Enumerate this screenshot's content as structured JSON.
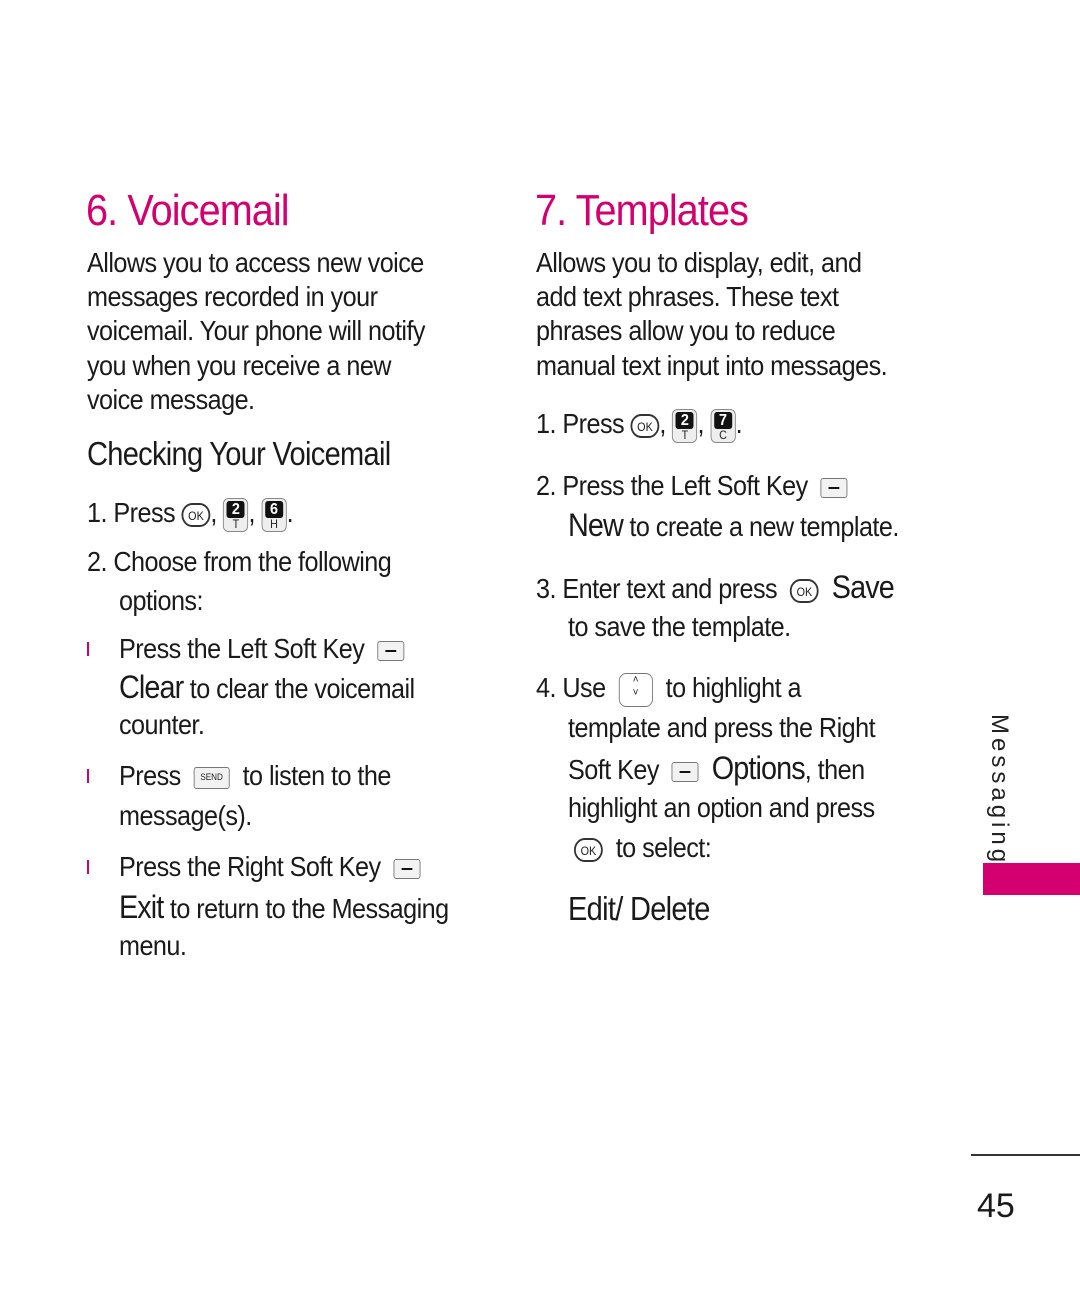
{
  "accent_color": "#d4006f",
  "left": {
    "title": "6. Voicemail",
    "intro": [
      "Allows you to access new voice",
      "messages recorded in your",
      "voicemail. Your phone will notify",
      "you when you receive a new",
      "voice message."
    ],
    "subheading": "Checking Your Voicemail",
    "step1": {
      "prefix": "1. Press",
      "keys": [
        "OK",
        "2",
        "T",
        "6",
        "H"
      ]
    },
    "step2": [
      "2. Choose from the following",
      "options:"
    ],
    "bullet1": {
      "a": "Press the Left Soft Key",
      "b": "Clear",
      "c": " to clear the voicemail",
      "d": "counter."
    },
    "bullet2": {
      "a": "Press",
      "key": "SEND",
      "b": "to listen to the",
      "c": "message(s)."
    },
    "bullet3": {
      "a": "Press the Right Soft Key",
      "b": "Exit",
      "c": " to return to the Messaging",
      "d": "menu."
    }
  },
  "right": {
    "title": "7. Templates",
    "intro": [
      "Allows you to display, edit, and",
      "add text phrases. These text",
      "phrases allow you to reduce",
      "manual text input into messages."
    ],
    "step1": {
      "prefix": "1. Press",
      "keys": [
        "OK",
        "2",
        "T",
        "7",
        "C"
      ]
    },
    "step2": {
      "a": "2. Press the Left Soft Key",
      "b": "New",
      "c": " to create a new template."
    },
    "step3": {
      "a": "3. Enter text and press",
      "b": "Save",
      "c": "to save the template."
    },
    "step4": {
      "a": "4. Use",
      "b": "to highlight a",
      "c": "template and press the Right",
      "d": "Soft Key",
      "e": "Options",
      "f": ", then",
      "g": "highlight an option and press",
      "h": "to select:"
    },
    "options": "Edit/ Delete"
  },
  "sidebar": {
    "section": "Messaging"
  },
  "page_number": "45"
}
